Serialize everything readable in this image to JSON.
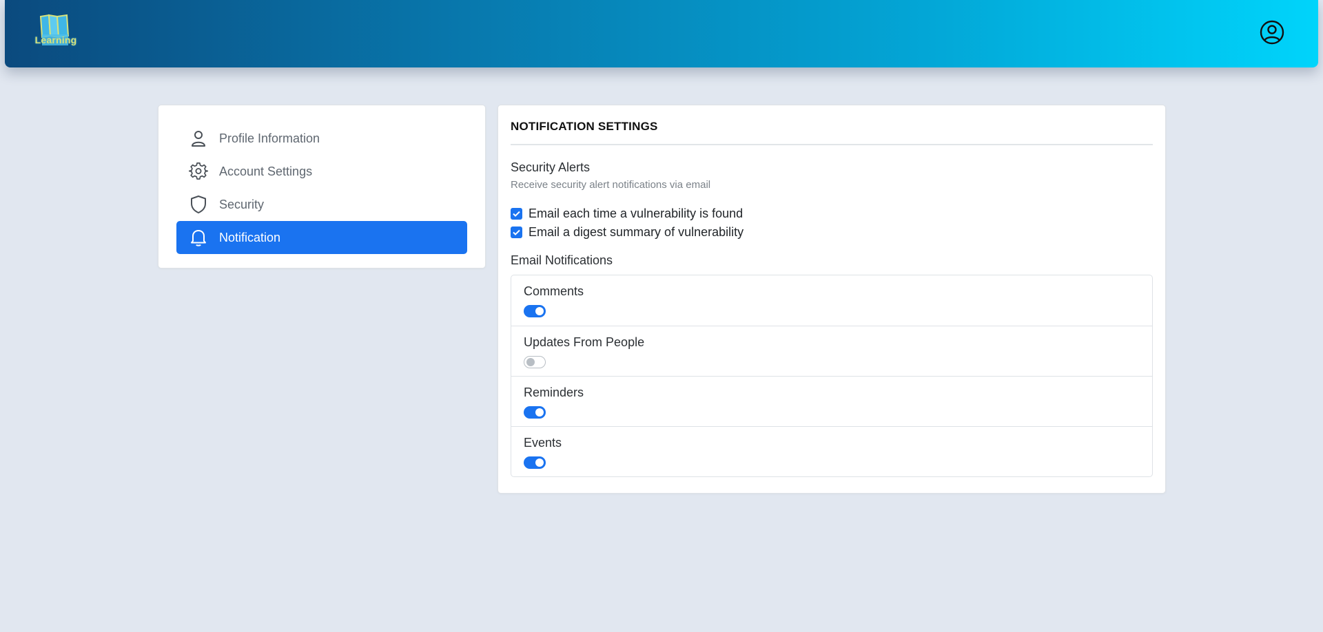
{
  "header": {
    "logo_text": "Learning",
    "logo_icon": "books-icon",
    "user_icon": "user-circle-icon"
  },
  "sidebar": {
    "items": [
      {
        "label": "Profile Information",
        "icon": "person-icon",
        "active": false
      },
      {
        "label": "Account Settings",
        "icon": "gear-icon",
        "active": false
      },
      {
        "label": "Security",
        "icon": "shield-icon",
        "active": false
      },
      {
        "label": "Notification",
        "icon": "bell-icon",
        "active": true
      }
    ]
  },
  "main": {
    "title": "NOTIFICATION SETTINGS",
    "security": {
      "title": "Security Alerts",
      "subtitle": "Receive security alert notifications via email",
      "options": [
        {
          "label": "Email each time a vulnerability is found",
          "checked": true
        },
        {
          "label": "Email a digest summary of vulnerability",
          "checked": true
        }
      ]
    },
    "email": {
      "title": "Email Notifications",
      "items": [
        {
          "label": "Comments",
          "enabled": true
        },
        {
          "label": "Updates From People",
          "enabled": false
        },
        {
          "label": "Reminders",
          "enabled": true
        },
        {
          "label": "Events",
          "enabled": true
        }
      ]
    }
  },
  "colors": {
    "accent": "#1a73f0",
    "background": "#e1e7f0",
    "header_start": "#0b4a7e",
    "header_end": "#00d4fb"
  }
}
